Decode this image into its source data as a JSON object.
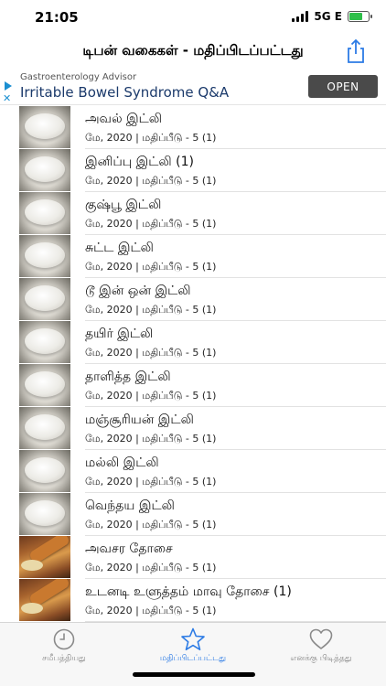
{
  "status_bar": {
    "time": "21:05",
    "network": "5G E"
  },
  "nav": {
    "title": "டிபன் வகைகள் - மதிப்பிடப்பட்டது",
    "share_icon": "share-icon"
  },
  "ad": {
    "advertiser": "Gastroenterology Advisor",
    "headline": "Irritable Bowel Syndrome Q&A",
    "cta": "OPEN"
  },
  "list": {
    "items": [
      {
        "title": "அவல் இட்லி",
        "subtitle": "மே, 2020 | மதிப்பீடு - 5 (1)",
        "thumb": "idli"
      },
      {
        "title": "இனிப்பு இட்லி (1)",
        "subtitle": "மே, 2020 | மதிப்பீடு - 5 (1)",
        "thumb": "idli"
      },
      {
        "title": "குஷ்பூ இட்லி",
        "subtitle": "மே, 2020 | மதிப்பீடு - 5 (1)",
        "thumb": "idli"
      },
      {
        "title": "சுட்ட இட்லி",
        "subtitle": "மே, 2020 | மதிப்பீடு - 5 (1)",
        "thumb": "idli"
      },
      {
        "title": "டூ இன் ஒன் இட்லி",
        "subtitle": "மே, 2020 | மதிப்பீடு - 5 (1)",
        "thumb": "idli"
      },
      {
        "title": "தயிர் இட்லி",
        "subtitle": "மே, 2020 | மதிப்பீடு - 5 (1)",
        "thumb": "idli"
      },
      {
        "title": "தாளித்த இட்லி",
        "subtitle": "மே, 2020 | மதிப்பீடு - 5 (1)",
        "thumb": "idli"
      },
      {
        "title": "மஞ்சூரியன் இட்லி",
        "subtitle": "மே, 2020 | மதிப்பீடு - 5 (1)",
        "thumb": "idli"
      },
      {
        "title": "மல்லி இட்லி",
        "subtitle": "மே, 2020 | மதிப்பீடு - 5 (1)",
        "thumb": "idli"
      },
      {
        "title": "வெந்தய இட்லி",
        "subtitle": "மே, 2020 | மதிப்பீடு - 5 (1)",
        "thumb": "idli"
      },
      {
        "title": "அவசர தோசை",
        "subtitle": "மே, 2020 | மதிப்பீடு - 5 (1)",
        "thumb": "dosa"
      },
      {
        "title": "உடனடி உளுத்தம் மாவு தோசை (1)",
        "subtitle": "மே, 2020 | மதிப்பீடு - 5 (1)",
        "thumb": "dosa"
      }
    ]
  },
  "tabs": [
    {
      "label": "சமீபத்தியது",
      "icon": "clock-icon",
      "active": false
    },
    {
      "label": "மதிப்பிடப்பட்டது",
      "icon": "star-icon",
      "active": true
    },
    {
      "label": "எனக்கு பிடித்தது",
      "icon": "heart-icon",
      "active": false
    }
  ],
  "colors": {
    "accent": "#2c7be5",
    "inactive": "#8a8a8a",
    "ad_button": "#4a4a4a"
  }
}
